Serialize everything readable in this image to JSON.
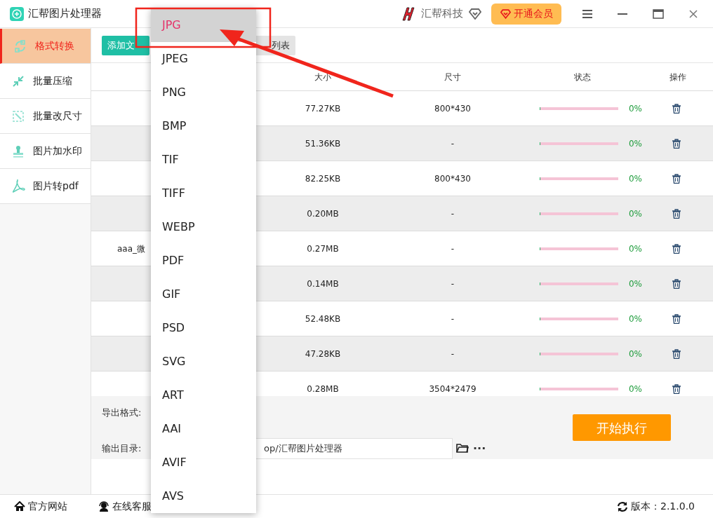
{
  "window": {
    "title": "汇帮图片处理器",
    "brand": "汇帮科技",
    "vip_button": "开通会员"
  },
  "sidebar": {
    "items": [
      {
        "label": "格式转换",
        "selected": true
      },
      {
        "label": "批量压缩",
        "selected": false
      },
      {
        "label": "批量改尺寸",
        "selected": false
      },
      {
        "label": "图片加水印",
        "selected": false
      },
      {
        "label": "图片转pdf",
        "selected": false
      }
    ]
  },
  "toolbar": {
    "add_button": "添加文",
    "clear_button": "列表"
  },
  "table": {
    "columns": [
      "大小",
      "尺寸",
      "状态",
      "操作"
    ],
    "rows": [
      {
        "name": "",
        "size": "77.27KB",
        "dimensions": "800*430",
        "level": 0,
        "percent": "0%"
      },
      {
        "name": "",
        "size": "51.36KB",
        "dimensions": "-",
        "level": 0,
        "percent": "0%"
      },
      {
        "name": "",
        "size": "82.25KB",
        "dimensions": "800*430",
        "level": 0,
        "percent": "0%"
      },
      {
        "name": "",
        "size": "0.20MB",
        "dimensions": "-",
        "level": 0,
        "percent": "0%"
      },
      {
        "name": "aaa_微",
        "size": "0.27MB",
        "dimensions": "-",
        "level": 0,
        "percent": "0%"
      },
      {
        "name": "",
        "size": "0.14MB",
        "dimensions": "-",
        "level": 0,
        "percent": "0%"
      },
      {
        "name": "",
        "size": "52.48KB",
        "dimensions": "-",
        "level": 0,
        "percent": "0%"
      },
      {
        "name": "",
        "size": "47.28KB",
        "dimensions": "-",
        "level": 0,
        "percent": "0%"
      },
      {
        "name": "",
        "size": "0.28MB",
        "dimensions": "3504*2479",
        "level": 0,
        "percent": "0%"
      }
    ]
  },
  "settings": {
    "format_label": "导出格式:",
    "output_label": "输出目录:",
    "output_path": "op/汇帮图片处理器",
    "more": "···",
    "start_button": "开始执行"
  },
  "format_dropdown": {
    "options": [
      {
        "label": "JPG",
        "selected": true
      },
      {
        "label": "JPEG",
        "selected": false
      },
      {
        "label": "PNG",
        "selected": false
      },
      {
        "label": "BMP",
        "selected": false
      },
      {
        "label": "TIF",
        "selected": false
      },
      {
        "label": "TIFF",
        "selected": false
      },
      {
        "label": "WEBP",
        "selected": false
      },
      {
        "label": "PDF",
        "selected": false
      },
      {
        "label": "GIF",
        "selected": false
      },
      {
        "label": "PSD",
        "selected": false
      },
      {
        "label": "SVG",
        "selected": false
      },
      {
        "label": "ART",
        "selected": false
      },
      {
        "label": "AAI",
        "selected": false
      },
      {
        "label": "AVIF",
        "selected": false
      },
      {
        "label": "AVS",
        "selected": false
      }
    ]
  },
  "status_bar": {
    "website": "官方网站",
    "support": "在线客服",
    "version": "版本：2.1.0.0"
  }
}
